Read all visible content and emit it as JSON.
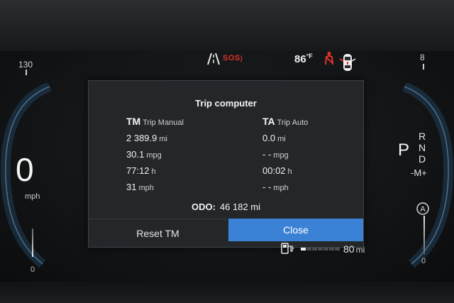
{
  "status_bar": {
    "speed_scale_max": "130",
    "gear_scale_top": "8",
    "sos_label": "SOS",
    "temperature": "86",
    "temperature_unit": "°F",
    "icons": [
      "lane-assist-icon",
      "sos-icon",
      "seatbelt-warning-icon",
      "car-door-icon"
    ]
  },
  "speed_gauge": {
    "value": "0",
    "unit": "mph",
    "scale_min": "0"
  },
  "gear_gauge": {
    "current": "P",
    "options": [
      "R",
      "N",
      "D"
    ],
    "manual": "-M+",
    "scale_min": "0",
    "drive_mode_label": "A"
  },
  "trip_computer": {
    "title": "Trip computer",
    "tm": {
      "abbr": "TM",
      "name": "Trip Manual",
      "distance": "2 389.9",
      "distance_unit": "mi",
      "economy": "30.1",
      "economy_unit": "mpg",
      "time": "77:12",
      "time_unit": "h",
      "avg_speed": "31",
      "avg_speed_unit": "mph"
    },
    "ta": {
      "abbr": "TA",
      "name": "Trip Auto",
      "distance": "0.0",
      "distance_unit": "mi",
      "economy": "- -",
      "economy_unit": "mpg",
      "time": "00:02",
      "time_unit": "h",
      "avg_speed": "- -",
      "avg_speed_unit": "mph"
    },
    "odo_label": "ODO:",
    "odo_value": "46 182 mi",
    "buttons": {
      "reset": "Reset TM",
      "close": "Close"
    }
  },
  "fuel": {
    "range": "80",
    "range_unit": "mi",
    "level_fraction": 0.14
  },
  "colors": {
    "accent": "#3b82d6",
    "warning_red": "#e0332d"
  }
}
